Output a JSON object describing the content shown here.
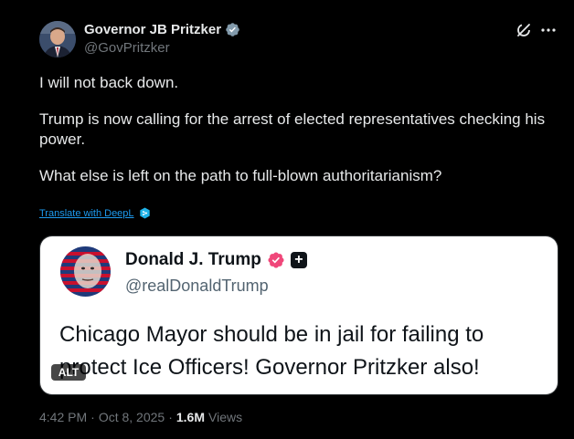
{
  "colors": {
    "background": "#000000",
    "text_primary": "#e7e9ea",
    "text_secondary": "#71767b",
    "link": "#1d9bf0",
    "verified_blue": "#1d9bf0",
    "verified_trump": "#f0477a"
  },
  "author": {
    "display_name": "Governor JB Pritzker",
    "handle": "@GovPritzker",
    "verified": true
  },
  "actions": {
    "grok_icon": "grok-icon",
    "more_icon": "more-icon"
  },
  "body": {
    "paragraphs": [
      "I will not back down.",
      "Trump is now calling for the arrest of elected representatives checking his power.",
      "What else is left on the path to full-blown authoritarianism?"
    ]
  },
  "translate": {
    "label": "Translate with DeepL"
  },
  "quoted_image": {
    "name": "Donald J. Trump",
    "handle": "@realDonaldTrump",
    "text": "Chicago Mayor should be in jail for failing to protect Ice Officers! Governor Pritzker also!",
    "alt_badge": "ALT"
  },
  "meta": {
    "time": "4:42 PM",
    "separator": "·",
    "date": "Oct 8, 2025",
    "views_count": "1.6M",
    "views_label": "Views"
  }
}
